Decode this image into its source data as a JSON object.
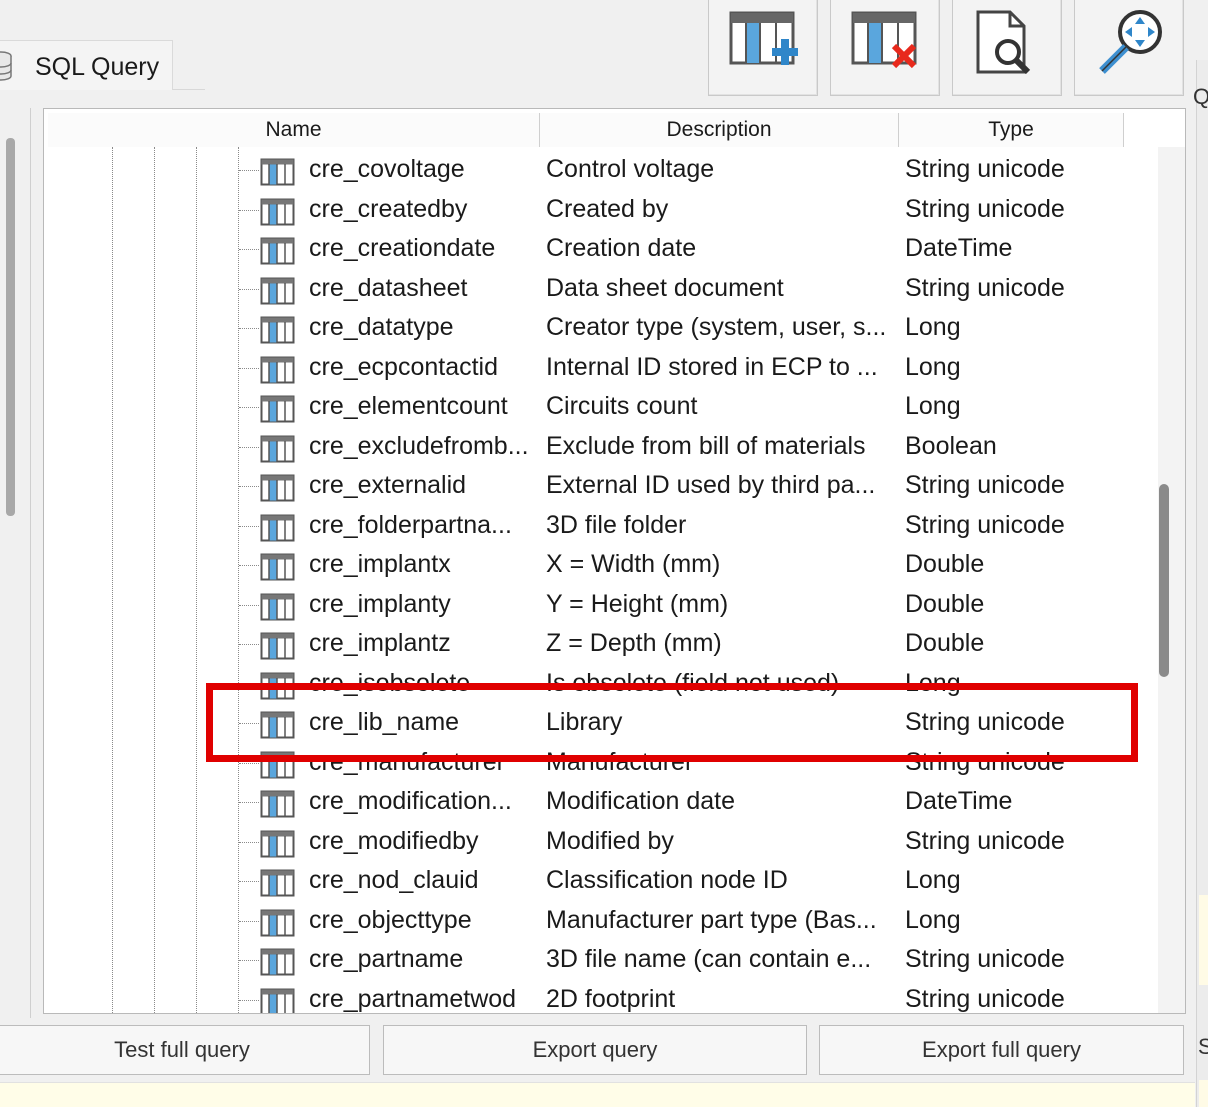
{
  "tab": {
    "label": "SQL Query",
    "icon": "database-icon"
  },
  "toolbar": {
    "buttons": [
      {
        "icon": "add-column-icon"
      },
      {
        "icon": "remove-column-icon"
      },
      {
        "icon": "preview-query-icon"
      },
      {
        "icon": "zoom-move-icon"
      }
    ]
  },
  "tree": {
    "columns": [
      "Name",
      "Description",
      "Type"
    ],
    "rows": [
      {
        "name": "cre_covoltage",
        "description": "Control voltage",
        "type": "String unicode"
      },
      {
        "name": "cre_createdby",
        "description": "Created by",
        "type": "String unicode"
      },
      {
        "name": "cre_creationdate",
        "description": "Creation date",
        "type": "DateTime"
      },
      {
        "name": "cre_datasheet",
        "description": "Data sheet document",
        "type": "String unicode"
      },
      {
        "name": "cre_datatype",
        "description": "Creator type (system, user, s...",
        "type": "Long"
      },
      {
        "name": "cre_ecpcontactid",
        "description": "Internal ID stored in ECP to ...",
        "type": "Long"
      },
      {
        "name": "cre_elementcount",
        "description": "Circuits count",
        "type": "Long"
      },
      {
        "name": "cre_excludefromb...",
        "description": "Exclude from bill of materials",
        "type": "Boolean"
      },
      {
        "name": "cre_externalid",
        "description": "External ID used by third pa...",
        "type": "String unicode"
      },
      {
        "name": "cre_folderpartna...",
        "description": "3D file folder",
        "type": "String unicode"
      },
      {
        "name": "cre_implantx",
        "description": "X = Width (mm)",
        "type": "Double"
      },
      {
        "name": "cre_implanty",
        "description": "Y = Height (mm)",
        "type": "Double"
      },
      {
        "name": "cre_implantz",
        "description": "Z = Depth (mm)",
        "type": "Double"
      },
      {
        "name": "cre_isobsolete",
        "description": "Is obsolete (field not used)",
        "type": "Long"
      },
      {
        "name": "cre_lib_name",
        "description": "Library",
        "type": "String unicode"
      },
      {
        "name": "cre_manufacturer",
        "description": "Manufacturer",
        "type": "String unicode"
      },
      {
        "name": "cre_modification...",
        "description": "Modification date",
        "type": "DateTime"
      },
      {
        "name": "cre_modifiedby",
        "description": "Modified by",
        "type": "String unicode"
      },
      {
        "name": "cre_nod_clauid",
        "description": "Classification node ID",
        "type": "Long"
      },
      {
        "name": "cre_objecttype",
        "description": "Manufacturer part type (Bas...",
        "type": "Long"
      },
      {
        "name": "cre_partname",
        "description": "3D file name (can contain e...",
        "type": "String unicode"
      },
      {
        "name": "cre_partnametwod",
        "description": "2D footprint",
        "type": "String unicode"
      }
    ],
    "row_icon": "table-column-icon",
    "highlighted_row": "cre_lib_name",
    "highlight_color": "#e00000"
  },
  "bottom": {
    "test_full_query": "Test full query",
    "export_query": "Export query",
    "export_full_query": "Export full query"
  },
  "right_edge": {
    "glyph_top": "Qu",
    "glyph_bottom": "S"
  }
}
